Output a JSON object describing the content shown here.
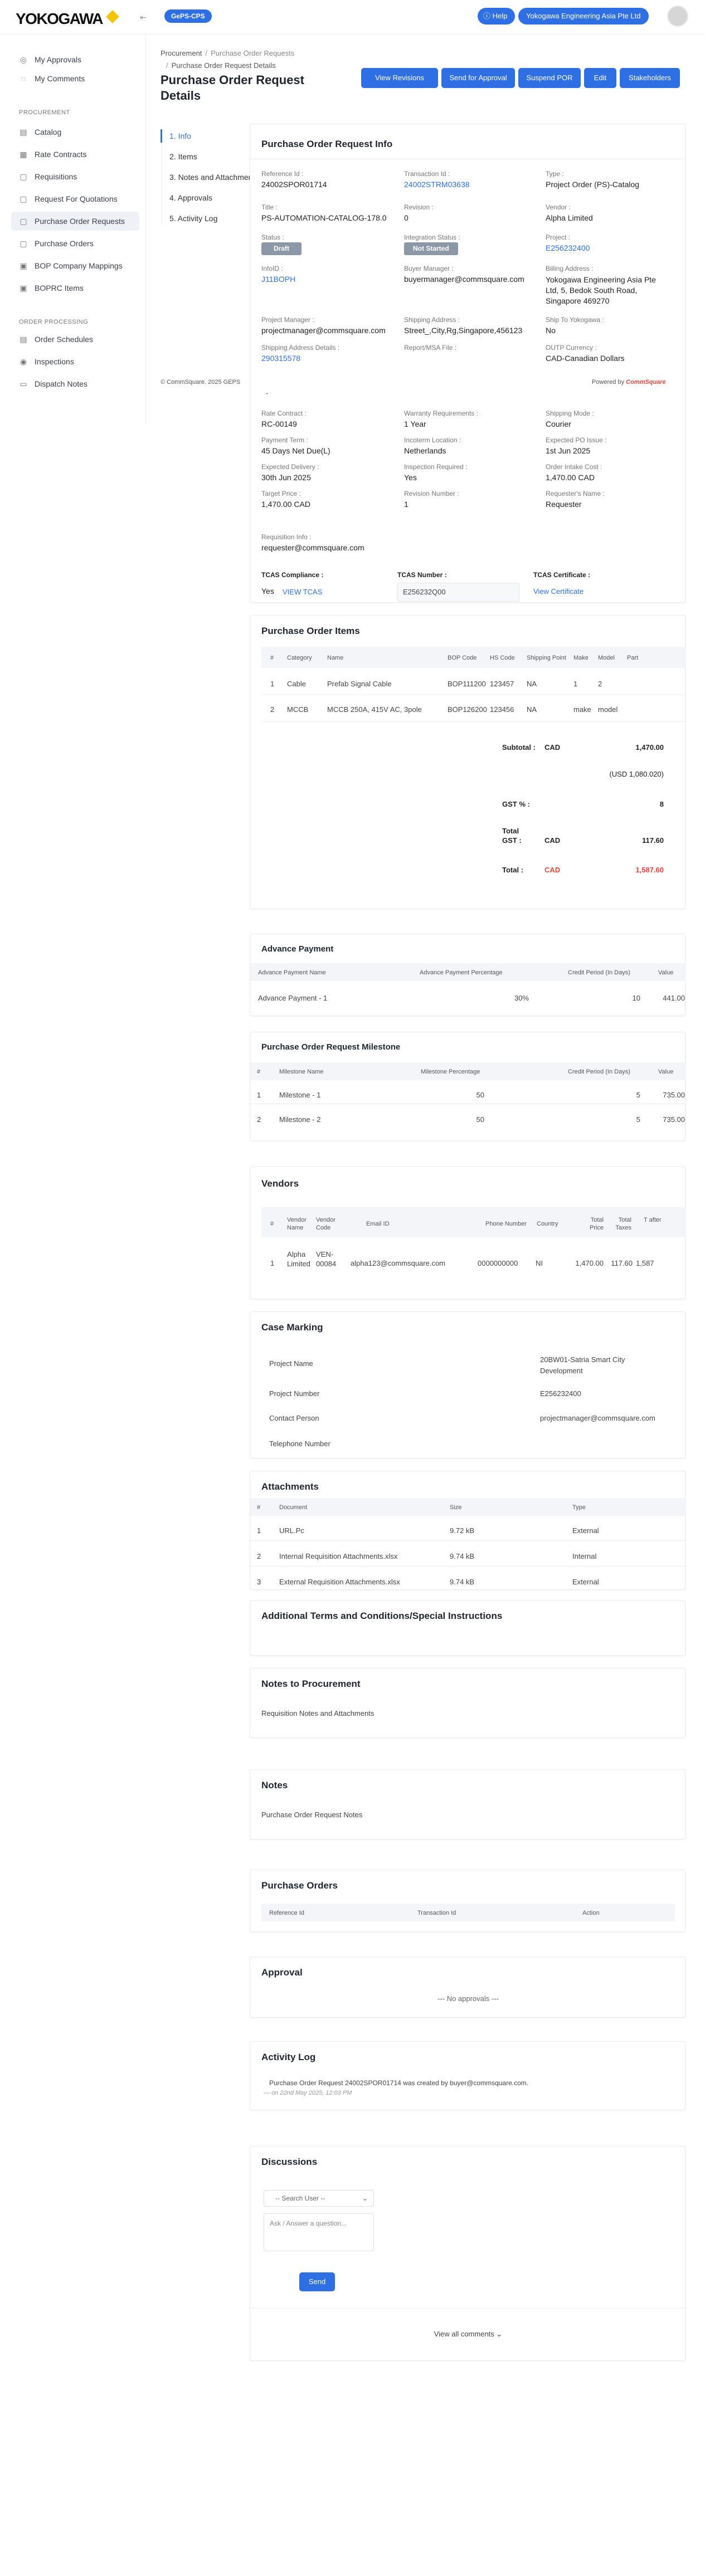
{
  "header": {
    "logo": "YOKOGAWA",
    "app_badge": "GePS-CPS",
    "help": "Help",
    "org": "Yokogawa Engineering Asia Pte Ltd"
  },
  "sidebar": {
    "top": [
      {
        "label": "My Approvals",
        "icon": "approvals-icon"
      },
      {
        "label": "My Comments",
        "icon": "comments-icon"
      }
    ],
    "sections": [
      {
        "heading": "PROCUREMENT",
        "items": [
          "Catalog",
          "Rate Contracts",
          "Requisitions",
          "Request For Quotations",
          "Purchase Order Requests",
          "Purchase Orders",
          "BOP Company Mappings",
          "BOPRC Items"
        ]
      },
      {
        "heading": "ORDER PROCESSING",
        "items": [
          "Order Schedules",
          "Inspections",
          "Dispatch Notes"
        ]
      }
    ]
  },
  "breadcrumb": {
    "root": "Procurement",
    "parent": "Purchase Order Requests",
    "current": "Purchase Order Request Details"
  },
  "page_title": "Purchase Order Request Details",
  "actions": [
    "View Revisions",
    "Send for Approval",
    "Suspend POR",
    "Edit",
    "Stakeholders"
  ],
  "tabs": [
    "1. Info",
    "2. Items",
    "3. Notes and Attachments",
    "4. Approvals",
    "5. Activity Log"
  ],
  "footer": {
    "copyright": "© CommSquare. 2025 GEPS",
    "powered": "Powered by",
    "brand": "CommSquare"
  },
  "info": {
    "title": "Purchase Order Request Info",
    "fields": [
      {
        "label": "Reference Id :",
        "value": "24002SPOR01714"
      },
      {
        "label": "Transaction Id :",
        "value": "24002STRM03638"
      },
      {
        "label": "Type :",
        "value": "Project Order (PS)-Catalog"
      },
      {
        "label": "Title :",
        "value": "PS-AUTOMATION-CATALOG-178.0"
      },
      {
        "label": "Revision :",
        "value": "0"
      },
      {
        "label": "Vendor :",
        "value": "Alpha Limited"
      },
      {
        "label": "Status :",
        "value": "Draft"
      },
      {
        "label": "Integration Status :",
        "value": "Not Started"
      },
      {
        "label": "Project :",
        "value": "E256232400"
      },
      {
        "label": "InfoID :",
        "value": "J11BOPH"
      },
      {
        "label": "Buyer Manager :",
        "value": "buyermanager@commsquare.com"
      },
      {
        "label": "Billing Address :",
        "value": "Yokogawa Engineering Asia Pte Ltd, 5, Bedok South Road, Singapore 469270"
      },
      {
        "label": "Project Manager :",
        "value": "projectmanager@commsquare.com"
      },
      {
        "label": "Shipping Address :",
        "value": "Street_,City,Rg,Singapore,456123"
      },
      {
        "label": "Ship To Yokogawa :",
        "value": "No"
      },
      {
        "label": "Shipping Address Details :",
        "value": "290315578"
      },
      {
        "label": "Report/MSA File :",
        "value": ""
      },
      {
        "label": "OUTP Currency :",
        "value": "CAD-Canadian Dollars"
      },
      {
        "label": "Rate Contract :",
        "value": "RC-00149"
      },
      {
        "label": "Warranty Requirements :",
        "value": "1 Year"
      },
      {
        "label": "Shipping Mode :",
        "value": "Courier"
      },
      {
        "label": "Payment Term :",
        "value": "45 Days Net Due(L)"
      },
      {
        "label": "Incoterm Location :",
        "value": "Netherlands"
      },
      {
        "label": "Expected PO Issue :",
        "value": "1st Jun 2025"
      },
      {
        "label": "Expected Delivery :",
        "value": "30th Jun 2025"
      },
      {
        "label": "Inspection Required :",
        "value": "Yes"
      },
      {
        "label": "Order Intake Cost :",
        "value": "1,470.00 CAD"
      },
      {
        "label": "Target Price :",
        "value": "1,470.00 CAD"
      },
      {
        "label": "Revision Number :",
        "value": "1"
      },
      {
        "label": "Requester's Name :",
        "value": "Requester"
      },
      {
        "label": "Requisition Info :",
        "value": "requester@commsquare.com"
      }
    ],
    "tcas_compliance_label": "TCAS Compliance :",
    "tcas_compliance_value": "Yes",
    "view_tcas": "VIEW TCAS",
    "tcas_number_label": "TCAS Number :",
    "tcas_number_value": "E256232Q00",
    "tcas_cert_label": "TCAS Certificate :",
    "view_cert": "View Certificate"
  },
  "items": {
    "title": "Purchase Order Items",
    "columns": [
      "#",
      "Category",
      "Name",
      "BOP Code",
      "HS Code",
      "Shipping Point",
      "Make",
      "Model",
      "Part"
    ],
    "rows": [
      [
        "1",
        "Cable",
        "Prefab Signal Cable",
        "BOP111200",
        "123457",
        "NA",
        "1",
        "2",
        ""
      ],
      [
        "2",
        "MCCB",
        "MCCB 250A, 415V AC, 3pole",
        "BOP126200",
        "123456",
        "NA",
        "make",
        "model",
        ""
      ]
    ],
    "subtotal_label": "Subtotal :",
    "subtotal_cur": "CAD",
    "subtotal": "1,470.00",
    "usd": "(USD 1,080.020)",
    "gst_label": "GST % :",
    "gst": "8",
    "total_gst_label": "Total GST :",
    "total_gst_cur": "CAD",
    "total_gst": "117.60",
    "total_label": "Total :",
    "total_cur": "CAD",
    "total": "1,587.60"
  },
  "advance": {
    "title": "Advance Payment",
    "columns": [
      "Advance Payment Name",
      "Advance Payment Percentage",
      "Credit Period (In Days)",
      "Value"
    ],
    "row": [
      "Advance Payment - 1",
      "30%",
      "10",
      "441.00"
    ]
  },
  "milestone": {
    "title": "Purchase Order Request Milestone",
    "columns": [
      "#",
      "Milestone Name",
      "Milestone Percentage",
      "Credit Period (In Days)",
      "Value"
    ],
    "rows": [
      [
        "1",
        "Milestone - 1",
        "50",
        "5",
        "735.00"
      ],
      [
        "2",
        "Milestone - 2",
        "50",
        "5",
        "735.00"
      ]
    ]
  },
  "vendors": {
    "title": "Vendors",
    "columns": [
      "#",
      "Vendor Name",
      "Vendor Code",
      "Email ID",
      "Phone Number",
      "Country",
      "Total Price",
      "Total Taxes",
      "T after"
    ],
    "row": [
      "1",
      "Alpha Limited",
      "VEN-00084",
      "alpha123@commsquare.com",
      "0000000000",
      "NI",
      "1,470.00",
      "117.60",
      "1,587"
    ]
  },
  "case": {
    "title": "Case Marking",
    "rows": [
      [
        "Project Name",
        "20BW01-Satria Smart City Development"
      ],
      [
        "Project Number",
        "E256232400"
      ],
      [
        "Contact Person",
        "projectmanager@commsquare.com"
      ],
      [
        "Telephone Number",
        ""
      ]
    ]
  },
  "attachments": {
    "title": "Attachments",
    "columns": [
      "#",
      "Document",
      "Size",
      "Type"
    ],
    "rows": [
      [
        "1",
        "URL.Pc",
        "9.72 kB",
        "External"
      ],
      [
        "2",
        "Internal Requisition Attachments.xlsx",
        "9.74 kB",
        "Internal"
      ],
      [
        "3",
        "External Requisition Attachments.xlsx",
        "9.74 kB",
        "External"
      ]
    ]
  },
  "terms": {
    "title": "Additional Terms and Conditions/Special Instructions"
  },
  "notes_proc": {
    "title": "Notes to Procurement",
    "text": "Requisition Notes and Attachments"
  },
  "notes": {
    "title": "Notes",
    "text": "Purchase Order Request Notes"
  },
  "purchase_orders": {
    "title": "Purchase Orders",
    "columns": [
      "Reference Id",
      "Transaction Id",
      "Action"
    ]
  },
  "approval": {
    "title": "Approval",
    "empty": "--- No approvals ---"
  },
  "activity": {
    "title": "Activity Log",
    "text": "Purchase Order Request 24002SPOR01714 was created by buyer@commsquare.com.",
    "time": "on 22nd May 2025, 12:03 PM"
  },
  "discussions": {
    "title": "Discussions",
    "select": "-- Search User --",
    "placeholder": "Ask / Answer a question...",
    "send": "Send",
    "view_all": "View all comments"
  },
  "colors": {
    "accent": "#2f6fe4",
    "badge": "#8c98a8",
    "total": "#e8443a"
  }
}
